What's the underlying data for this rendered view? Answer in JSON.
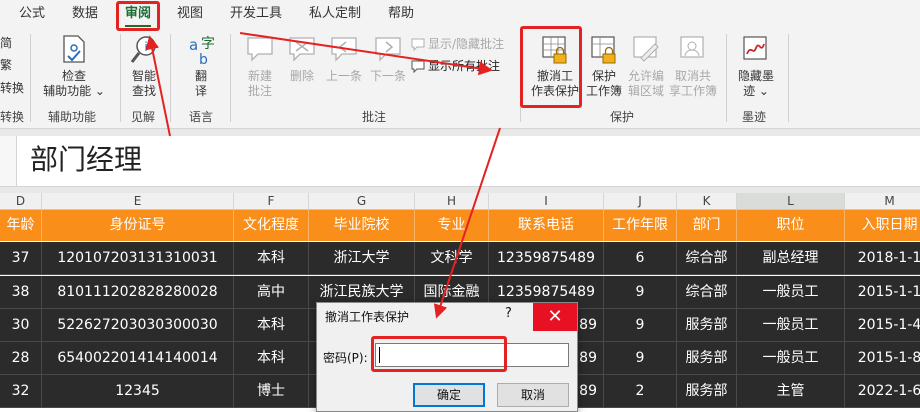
{
  "tabs": [
    {
      "label": "公式",
      "active": false
    },
    {
      "label": "数据",
      "active": false
    },
    {
      "label": "审阅",
      "active": true
    },
    {
      "label": "视图",
      "active": false
    },
    {
      "label": "开发工具",
      "active": false
    },
    {
      "label": "私人定制",
      "active": false
    },
    {
      "label": "帮助",
      "active": false
    }
  ],
  "ribbon": {
    "left_stub": [
      "简",
      "繁",
      "转换"
    ],
    "left_stub_label": "转换",
    "groups": {
      "assist": {
        "label": "辅助功能",
        "check": "检查\n辅助功能 ⌄"
      },
      "insight": {
        "label": "见解",
        "smart_lookup": "智能\n查找"
      },
      "language": {
        "label": "语言",
        "translate": "翻\n译"
      },
      "comments": {
        "label": "批注",
        "new": "新建\n批注",
        "delete": "删除",
        "prev": "上一条",
        "next": "下一条",
        "show_hide": "显示/隐藏批注",
        "show_all": "显示所有批注"
      },
      "protect": {
        "label": "保护",
        "unprotect_sheet": "撤消工\n作表保护",
        "protect_workbook": "保护\n工作簿",
        "allow_edit": "允许编\n辑区域",
        "unshare": "取消共\n享工作簿"
      },
      "ink": {
        "label": "墨迹",
        "hide_ink": "隐藏墨\n迹 ⌄"
      }
    }
  },
  "formula_bar": {
    "value": "部门经理"
  },
  "grid": {
    "columns": [
      "D",
      "E",
      "F",
      "G",
      "H",
      "I",
      "J",
      "K",
      "L",
      "M"
    ],
    "selected_column": "L",
    "header_row": [
      "年龄",
      "身份证号",
      "文化程度",
      "毕业院校",
      "专业",
      "联系电话",
      "工作年限",
      "部门",
      "职位",
      "入职日期"
    ],
    "rows": [
      [
        "37",
        "120107203131310031",
        "本科",
        "浙江大学",
        "文科学",
        "12359875489",
        "6",
        "综合部",
        "副总经理",
        "2018-1-1"
      ],
      [
        "38",
        "810111202828280028",
        "高中",
        "浙江民族大学",
        "国际金融",
        "12359875489",
        "9",
        "综合部",
        "一般员工",
        "2015-1-1"
      ],
      [
        "30",
        "522627203030300030",
        "本科",
        "",
        "",
        "89",
        "9",
        "服务部",
        "一般员工",
        "2015-1-4"
      ],
      [
        "28",
        "654002201414140014",
        "本科",
        "",
        "",
        "89",
        "9",
        "服务部",
        "一般员工",
        "2015-1-8"
      ],
      [
        "32",
        "12345",
        "博士",
        "",
        "",
        "89",
        "2",
        "服务部",
        "主管",
        "2022-1-6"
      ]
    ]
  },
  "dialog": {
    "title": "撤消工作表保护",
    "help": "?",
    "close": "✕",
    "password_label": "密码(P):",
    "password_value": "",
    "ok": "确定",
    "cancel": "取消"
  },
  "colors": {
    "ribbon_bg": "#f3f3f3",
    "active_tab": "#1d6b35",
    "header_fill": "#f98e1a",
    "data_fill": "#2b2b2b",
    "annotation_red": "#e52222",
    "close_red": "#e81123"
  },
  "icons": {
    "check": "accessibility-check-icon",
    "smart_lookup": "smart-lookup-icon",
    "translate": "translate-icon",
    "comment": "comment-icon",
    "sheet_lock": "sheet-lock-icon",
    "ink": "ink-icon"
  }
}
